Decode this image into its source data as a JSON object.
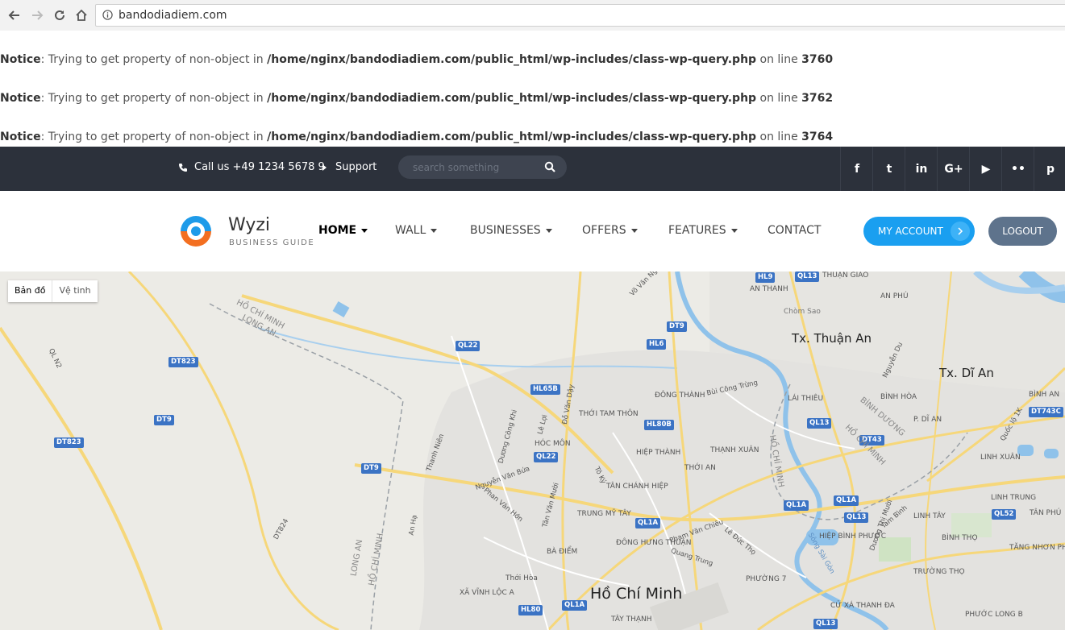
{
  "browser": {
    "url": "bandodiadiem.com"
  },
  "notices": [
    {
      "label": "Notice",
      "text": ": Trying to get property of non-object in ",
      "path": "/home/nginx/bandodiadiem.com/public_html/wp-includes/class-wp-query.php",
      "on_line": " on line ",
      "line": "3760"
    },
    {
      "label": "Notice",
      "text": ": Trying to get property of non-object in ",
      "path": "/home/nginx/bandodiadiem.com/public_html/wp-includes/class-wp-query.php",
      "on_line": " on line ",
      "line": "3762"
    },
    {
      "label": "Notice",
      "text": ": Trying to get property of non-object in ",
      "path": "/home/nginx/bandodiadiem.com/public_html/wp-includes/class-wp-query.php",
      "on_line": " on line ",
      "line": "3764"
    }
  ],
  "topbar": {
    "phone": "Call us +49 1234 5678 9",
    "support": "Support",
    "search_placeholder": "search something",
    "social": [
      "facebook-icon",
      "twitter-icon",
      "linkedin-icon",
      "google-plus-icon",
      "youtube-icon",
      "flickr-icon",
      "pinterest-icon"
    ],
    "social_glyphs": [
      "f",
      "t",
      "in",
      "G+",
      "▶",
      "••",
      "p"
    ]
  },
  "header": {
    "brand": "Wyzi",
    "tagline": "BUSINESS GUIDE",
    "menu": [
      {
        "label": "HOME",
        "caret": true,
        "active": true
      },
      {
        "label": "WALL",
        "caret": true
      },
      {
        "label": "BUSINESSES",
        "caret": true
      },
      {
        "label": "OFFERS",
        "caret": true
      },
      {
        "label": "FEATURES",
        "caret": true
      },
      {
        "label": "CONTACT",
        "caret": false
      }
    ],
    "my_account": "MY ACCOUNT",
    "logout": "LOGOUT"
  },
  "map": {
    "type_map": "Bản đồ",
    "type_satellite": "Vệ tinh",
    "cities": [
      "Tx. Thuận An",
      "Tx. Dĩ An",
      "Hồ Chí Minh"
    ],
    "shields": [
      "HL9",
      "QL13",
      "DT9",
      "HL6",
      "QL22",
      "DT823",
      "DT9",
      "DT823",
      "HL65B",
      "HL80B",
      "QL22",
      "DT9",
      "QL1A",
      "HL80",
      "QL1A",
      "QL13",
      "DT43",
      "QL1A",
      "QL1A",
      "QL13",
      "QL52",
      "QL13",
      "DT743C"
    ],
    "places": [
      "AN THANH",
      "THUẬN GIAO",
      "AN PHÚ",
      "Chòm Sao",
      "ĐÔNG THÀNH",
      "LÁI THIÊU",
      "BÌNH HÒA",
      "BÌNH AN",
      "P. DĨ AN",
      "THỚI TAM THÔN",
      "HÓC MÔN",
      "HIỆP THÀNH",
      "THẠNH XUÂN",
      "THỚI AN",
      "TÂN CHÁNH HIỆP",
      "TRUNG MỸ TÂY",
      "ĐÔNG HƯNG THUẬN",
      "BÀ ĐIỂM",
      "Thới Hòa",
      "XÃ VĨNH LỘC A",
      "TÂY THẠNH",
      "PHƯỜNG 7",
      "HIỆP BÌNH PHƯỚC",
      "LINH XUÂN",
      "LINH TRUNG",
      "LINH TÂY",
      "TÂN PHÚ",
      "BÌNH THỌ",
      "TĂNG NHƠN PHÚ A",
      "TRƯỜNG THỌ",
      "CỬ XÁ THANH ĐA",
      "PHƯỚC LONG B"
    ],
    "roads": [
      "Nguyễn Văn Bứa",
      "QL N2",
      "Đỗ Văn Dậy",
      "Bùi Công Trừng",
      "Nguyễn Du",
      "Quốc lộ 1K",
      "Phạm Văn Chiêu",
      "Quang Trung",
      "Lê Đức Thọ",
      "Tô Ký",
      "Phan Văn Hớn",
      "Tân Văn Mười",
      "Dương Công Khi",
      "Lê Lợi",
      "Thanh Niên",
      "An Hạ",
      "Sông Sài Gòn",
      "Võ Văn Ngân",
      "Tam Bình",
      "Dương Thị Mười",
      "DT824"
    ],
    "boundary_labels": [
      "HỒ CHÍ MINH",
      "LONG AN",
      "BÌNH DƯƠNG",
      "HỒ CHÍ MINH",
      "LONG AN",
      "HỒ CHÍ MINH",
      "HỒ CHÍ MINH"
    ],
    "colors": {
      "land": "#ecebe6",
      "urban": "#e3e2df",
      "water": "#8fc2ea",
      "major_road": "#f6d77a",
      "minor_road": "#ffffff",
      "park": "#cfe3c3"
    }
  }
}
